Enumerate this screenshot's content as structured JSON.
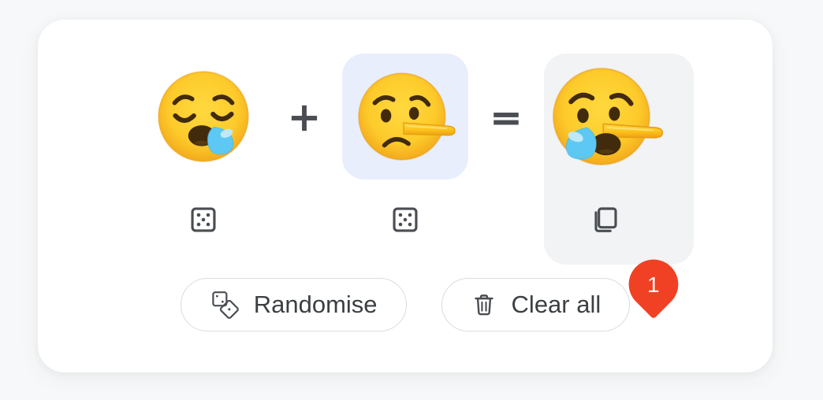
{
  "app": {
    "background_color": "#f7f8f9",
    "card_color": "#ffffff"
  },
  "equation": {
    "operators": {
      "plus": "+",
      "equals": "="
    },
    "slots": [
      {
        "id": "slot-1",
        "role": "first-operand",
        "emoji_name": "sleepy-face",
        "emoji_char": "😪",
        "selected": false,
        "tile_background": "transparent",
        "action_icon": "dice-icon",
        "action_label": "Randomise this emoji"
      },
      {
        "id": "slot-2",
        "role": "second-operand",
        "emoji_name": "lying-face",
        "emoji_char": "🤥",
        "selected": true,
        "tile_background": "#e8eefc",
        "action_icon": "dice-icon",
        "action_label": "Randomise this emoji"
      },
      {
        "id": "slot-3",
        "role": "result",
        "emoji_name": "sleepy-lying-face-mashup",
        "emoji_char": "",
        "selected": false,
        "tile_background": "#f1f3f4",
        "action_icon": "copy-icon",
        "action_label": "Copy result"
      }
    ]
  },
  "badge": {
    "count": "1",
    "color": "#f04124",
    "text_color": "#ffffff"
  },
  "buttons": [
    {
      "id": "randomise-button",
      "label": "Randomise",
      "icon": "two-dice-icon"
    },
    {
      "id": "clear-all-button",
      "label": "Clear all",
      "icon": "trash-icon"
    }
  ],
  "colors": {
    "icon_gray": "#4a4d52",
    "text_gray": "#3c4043",
    "border_gray": "#dadce0",
    "selected_blue": "#e8eefc",
    "result_gray": "#f1f3f4",
    "emoji_yellow": "#fcc21b",
    "emoji_tear_blue": "#5ec8f5",
    "emoji_dark": "#422b0d"
  }
}
